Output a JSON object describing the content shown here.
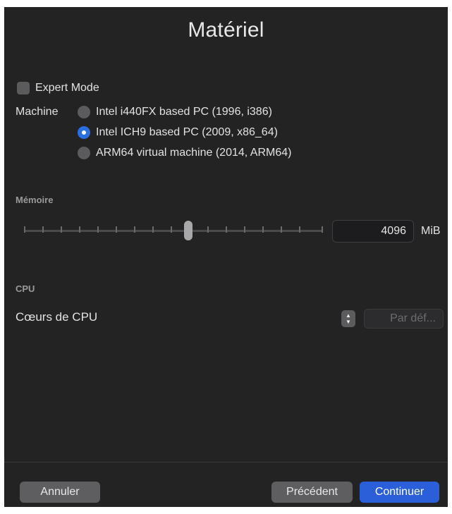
{
  "window": {
    "title": "Matériel"
  },
  "system": {
    "expert_mode_label": "Expert Mode",
    "expert_mode_checked": false,
    "machine_label": "Machine",
    "machine_options": [
      {
        "label": "Intel i440FX based PC (1996, i386)",
        "selected": false
      },
      {
        "label": "Intel ICH9 based PC (2009, x86_64)",
        "selected": true
      },
      {
        "label": "ARM64 virtual machine (2014, ARM64)",
        "selected": false
      }
    ]
  },
  "memory": {
    "section_title": "Mémoire",
    "value": "4096",
    "unit": "MiB"
  },
  "cpu": {
    "section_title": "CPU",
    "cores_label": "Cœurs de CPU",
    "cores_placeholder": "Par déf..."
  },
  "footer": {
    "cancel_label": "Annuler",
    "previous_label": "Précédent",
    "continue_label": "Continuer"
  },
  "colors": {
    "background": "#232324",
    "accent": "#2b5fd9",
    "radio_selected": "#2a6fe0",
    "control": "#5e5e60"
  }
}
